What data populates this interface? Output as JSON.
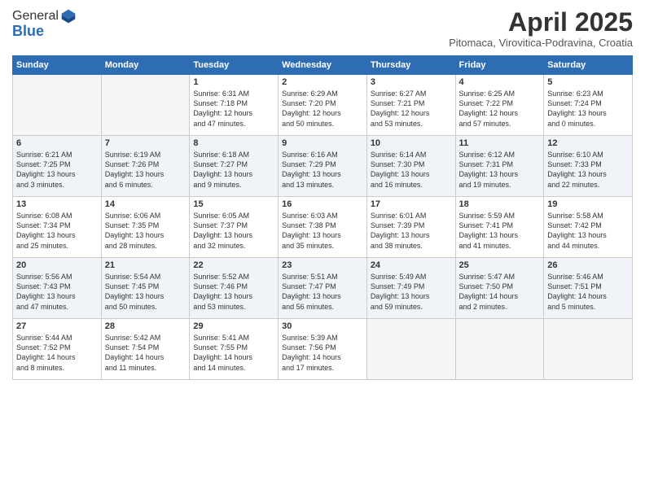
{
  "header": {
    "logo_general": "General",
    "logo_blue": "Blue",
    "month": "April 2025",
    "location": "Pitomaca, Virovitica-Podravina, Croatia"
  },
  "weekdays": [
    "Sunday",
    "Monday",
    "Tuesday",
    "Wednesday",
    "Thursday",
    "Friday",
    "Saturday"
  ],
  "weeks": [
    [
      {
        "day": "",
        "info": ""
      },
      {
        "day": "",
        "info": ""
      },
      {
        "day": "1",
        "info": "Sunrise: 6:31 AM\nSunset: 7:18 PM\nDaylight: 12 hours\nand 47 minutes."
      },
      {
        "day": "2",
        "info": "Sunrise: 6:29 AM\nSunset: 7:20 PM\nDaylight: 12 hours\nand 50 minutes."
      },
      {
        "day": "3",
        "info": "Sunrise: 6:27 AM\nSunset: 7:21 PM\nDaylight: 12 hours\nand 53 minutes."
      },
      {
        "day": "4",
        "info": "Sunrise: 6:25 AM\nSunset: 7:22 PM\nDaylight: 12 hours\nand 57 minutes."
      },
      {
        "day": "5",
        "info": "Sunrise: 6:23 AM\nSunset: 7:24 PM\nDaylight: 13 hours\nand 0 minutes."
      }
    ],
    [
      {
        "day": "6",
        "info": "Sunrise: 6:21 AM\nSunset: 7:25 PM\nDaylight: 13 hours\nand 3 minutes."
      },
      {
        "day": "7",
        "info": "Sunrise: 6:19 AM\nSunset: 7:26 PM\nDaylight: 13 hours\nand 6 minutes."
      },
      {
        "day": "8",
        "info": "Sunrise: 6:18 AM\nSunset: 7:27 PM\nDaylight: 13 hours\nand 9 minutes."
      },
      {
        "day": "9",
        "info": "Sunrise: 6:16 AM\nSunset: 7:29 PM\nDaylight: 13 hours\nand 13 minutes."
      },
      {
        "day": "10",
        "info": "Sunrise: 6:14 AM\nSunset: 7:30 PM\nDaylight: 13 hours\nand 16 minutes."
      },
      {
        "day": "11",
        "info": "Sunrise: 6:12 AM\nSunset: 7:31 PM\nDaylight: 13 hours\nand 19 minutes."
      },
      {
        "day": "12",
        "info": "Sunrise: 6:10 AM\nSunset: 7:33 PM\nDaylight: 13 hours\nand 22 minutes."
      }
    ],
    [
      {
        "day": "13",
        "info": "Sunrise: 6:08 AM\nSunset: 7:34 PM\nDaylight: 13 hours\nand 25 minutes."
      },
      {
        "day": "14",
        "info": "Sunrise: 6:06 AM\nSunset: 7:35 PM\nDaylight: 13 hours\nand 28 minutes."
      },
      {
        "day": "15",
        "info": "Sunrise: 6:05 AM\nSunset: 7:37 PM\nDaylight: 13 hours\nand 32 minutes."
      },
      {
        "day": "16",
        "info": "Sunrise: 6:03 AM\nSunset: 7:38 PM\nDaylight: 13 hours\nand 35 minutes."
      },
      {
        "day": "17",
        "info": "Sunrise: 6:01 AM\nSunset: 7:39 PM\nDaylight: 13 hours\nand 38 minutes."
      },
      {
        "day": "18",
        "info": "Sunrise: 5:59 AM\nSunset: 7:41 PM\nDaylight: 13 hours\nand 41 minutes."
      },
      {
        "day": "19",
        "info": "Sunrise: 5:58 AM\nSunset: 7:42 PM\nDaylight: 13 hours\nand 44 minutes."
      }
    ],
    [
      {
        "day": "20",
        "info": "Sunrise: 5:56 AM\nSunset: 7:43 PM\nDaylight: 13 hours\nand 47 minutes."
      },
      {
        "day": "21",
        "info": "Sunrise: 5:54 AM\nSunset: 7:45 PM\nDaylight: 13 hours\nand 50 minutes."
      },
      {
        "day": "22",
        "info": "Sunrise: 5:52 AM\nSunset: 7:46 PM\nDaylight: 13 hours\nand 53 minutes."
      },
      {
        "day": "23",
        "info": "Sunrise: 5:51 AM\nSunset: 7:47 PM\nDaylight: 13 hours\nand 56 minutes."
      },
      {
        "day": "24",
        "info": "Sunrise: 5:49 AM\nSunset: 7:49 PM\nDaylight: 13 hours\nand 59 minutes."
      },
      {
        "day": "25",
        "info": "Sunrise: 5:47 AM\nSunset: 7:50 PM\nDaylight: 14 hours\nand 2 minutes."
      },
      {
        "day": "26",
        "info": "Sunrise: 5:46 AM\nSunset: 7:51 PM\nDaylight: 14 hours\nand 5 minutes."
      }
    ],
    [
      {
        "day": "27",
        "info": "Sunrise: 5:44 AM\nSunset: 7:52 PM\nDaylight: 14 hours\nand 8 minutes."
      },
      {
        "day": "28",
        "info": "Sunrise: 5:42 AM\nSunset: 7:54 PM\nDaylight: 14 hours\nand 11 minutes."
      },
      {
        "day": "29",
        "info": "Sunrise: 5:41 AM\nSunset: 7:55 PM\nDaylight: 14 hours\nand 14 minutes."
      },
      {
        "day": "30",
        "info": "Sunrise: 5:39 AM\nSunset: 7:56 PM\nDaylight: 14 hours\nand 17 minutes."
      },
      {
        "day": "",
        "info": ""
      },
      {
        "day": "",
        "info": ""
      },
      {
        "day": "",
        "info": ""
      }
    ]
  ]
}
